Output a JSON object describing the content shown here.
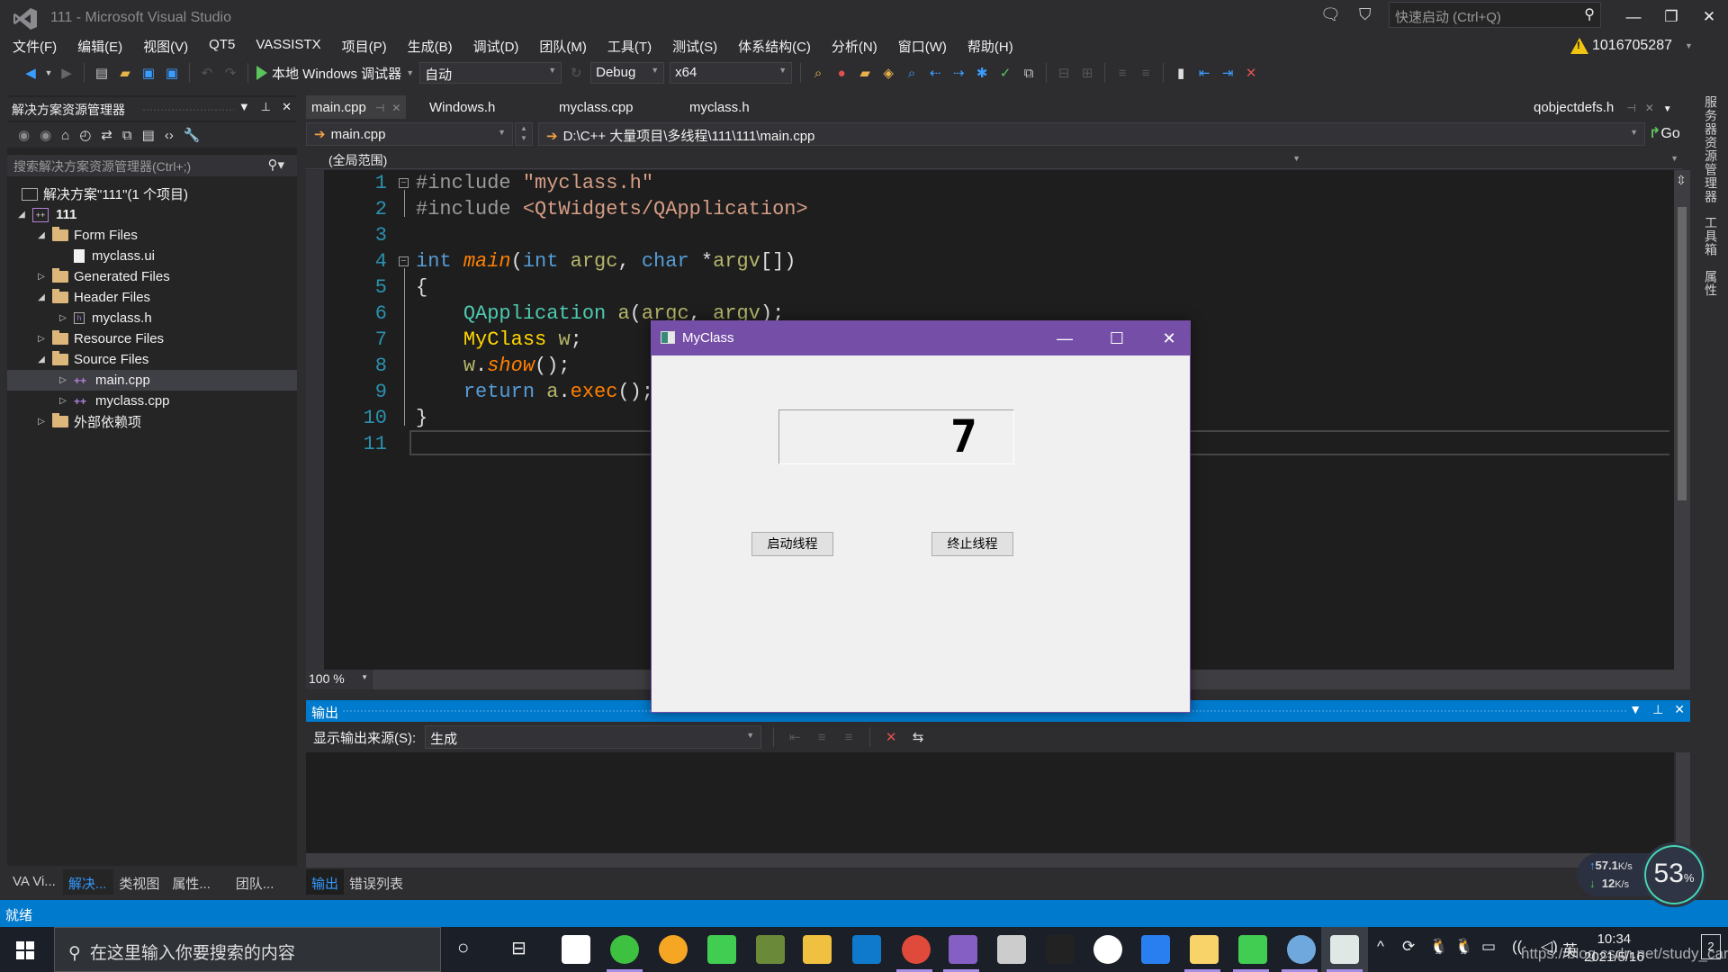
{
  "window": {
    "title": "111 - Microsoft Visual Studio",
    "quick_launch_placeholder": "快速启动 (Ctrl+Q)",
    "account": "1016705287"
  },
  "menu": [
    "文件(F)",
    "编辑(E)",
    "视图(V)",
    "QT5",
    "VASSISTX",
    "项目(P)",
    "生成(B)",
    "调试(D)",
    "团队(M)",
    "工具(T)",
    "测试(S)",
    "体系结构(C)",
    "分析(N)",
    "窗口(W)",
    "帮助(H)"
  ],
  "toolbar": {
    "run_label": "本地 Windows 调试器",
    "solution_config_auto": "自动",
    "configuration": "Debug",
    "platform": "x64"
  },
  "solution_explorer": {
    "title": "解决方案资源管理器",
    "search_placeholder": "搜索解决方案资源管理器(Ctrl+;)",
    "tree": [
      {
        "label": "解决方案\"111\"(1 个项目)",
        "level": 0,
        "type": "solution",
        "expander": ""
      },
      {
        "label": "111",
        "level": 0,
        "type": "project",
        "expander": "◢"
      },
      {
        "label": "Form Files",
        "level": 1,
        "type": "folder",
        "expander": "◢"
      },
      {
        "label": "myclass.ui",
        "level": 2,
        "type": "file",
        "expander": ""
      },
      {
        "label": "Generated Files",
        "level": 1,
        "type": "folder",
        "expander": "▷"
      },
      {
        "label": "Header Files",
        "level": 1,
        "type": "folder",
        "expander": "◢"
      },
      {
        "label": "myclass.h",
        "level": 2,
        "type": "header",
        "expander": "▷"
      },
      {
        "label": "Resource Files",
        "level": 1,
        "type": "folder",
        "expander": "▷"
      },
      {
        "label": "Source Files",
        "level": 1,
        "type": "folder",
        "expander": "◢"
      },
      {
        "label": "main.cpp",
        "level": 2,
        "type": "cpp",
        "expander": "▷",
        "selected": true
      },
      {
        "label": "myclass.cpp",
        "level": 2,
        "type": "cpp",
        "expander": "▷"
      },
      {
        "label": "外部依赖项",
        "level": 1,
        "type": "external",
        "expander": "▷"
      }
    ],
    "bottom_tabs": [
      "VA Vi...",
      "解决...",
      "类视图",
      "属性...",
      "团队..."
    ],
    "active_bottom_tab": 1
  },
  "editor": {
    "tabs": [
      "main.cpp",
      "Windows.h",
      "myclass.cpp",
      "myclass.h"
    ],
    "right_tab": "qobjectdefs.h",
    "nav_file": "main.cpp",
    "nav_path": "D:\\C++ 大量项目\\多线程\\111\\111\\main.cpp",
    "go_label": "Go",
    "scope": "(全局范围)",
    "zoom": "100 %",
    "line_numbers": [
      "1",
      "2",
      "3",
      "4",
      "5",
      "6",
      "7",
      "8",
      "9",
      "10",
      "11"
    ]
  },
  "code": [
    [
      {
        "t": "#include ",
        "c": "pp"
      },
      {
        "t": "\"myclass.h\"",
        "c": "str"
      }
    ],
    [
      {
        "t": "#include ",
        "c": "pp"
      },
      {
        "t": "<QtWidgets/QApplication>",
        "c": "str"
      }
    ],
    [],
    [
      {
        "t": "int ",
        "c": "kw"
      },
      {
        "t": "main",
        "c": "fn"
      },
      {
        "t": "(",
        "c": "plain"
      },
      {
        "t": "int ",
        "c": "kw"
      },
      {
        "t": "argc",
        "c": "var"
      },
      {
        "t": ", ",
        "c": "plain"
      },
      {
        "t": "char ",
        "c": "kw"
      },
      {
        "t": "*",
        "c": "plain"
      },
      {
        "t": "argv",
        "c": "var"
      },
      {
        "t": "[])",
        "c": "plain"
      }
    ],
    [
      {
        "t": "{",
        "c": "plain"
      }
    ],
    [
      {
        "t": "    ",
        "c": "plain"
      },
      {
        "t": "QApplication ",
        "c": "type"
      },
      {
        "t": "a",
        "c": "var"
      },
      {
        "t": "(",
        "c": "plain"
      },
      {
        "t": "argc",
        "c": "var"
      },
      {
        "t": ", ",
        "c": "plain"
      },
      {
        "t": "argv",
        "c": "var"
      },
      {
        "t": ");",
        "c": "plain"
      }
    ],
    [
      {
        "t": "    ",
        "c": "plain"
      },
      {
        "t": "MyClass ",
        "c": "cls"
      },
      {
        "t": "w",
        "c": "var"
      },
      {
        "t": ";",
        "c": "plain"
      }
    ],
    [
      {
        "t": "    ",
        "c": "plain"
      },
      {
        "t": "w",
        "c": "var"
      },
      {
        "t": ".",
        "c": "plain"
      },
      {
        "t": "show",
        "c": "fn"
      },
      {
        "t": "();",
        "c": "plain"
      }
    ],
    [
      {
        "t": "    ",
        "c": "plain"
      },
      {
        "t": "return ",
        "c": "kw"
      },
      {
        "t": "a",
        "c": "var"
      },
      {
        "t": ".",
        "c": "plain"
      },
      {
        "t": "exec",
        "c": "mth"
      },
      {
        "t": "();",
        "c": "plain"
      }
    ],
    [
      {
        "t": "}",
        "c": "plain"
      }
    ],
    []
  ],
  "right_vertical_tabs": [
    "服务器资源管理器",
    "工具箱",
    "属性"
  ],
  "output": {
    "title": "输出",
    "source_label": "显示输出来源(S):",
    "source_value": "生成",
    "tabs": [
      "输出",
      "错误列表"
    ]
  },
  "status": "就绪",
  "myclass_window": {
    "title": "MyClass",
    "lcd_value": "7",
    "start_button": "启动线程",
    "stop_button": "终止线程"
  },
  "net_widget": {
    "upload": "57.1",
    "download": "12",
    "unit": "K/s",
    "cpu": "53",
    "cpu_unit": "%"
  },
  "taskbar": {
    "search_placeholder": "在这里输入你要搜索的内容",
    "time": "10:34",
    "date": "2021/5/16",
    "ime": "英",
    "notifications": "2",
    "watermark": "https://blog.csdn.net/study_cardi"
  }
}
